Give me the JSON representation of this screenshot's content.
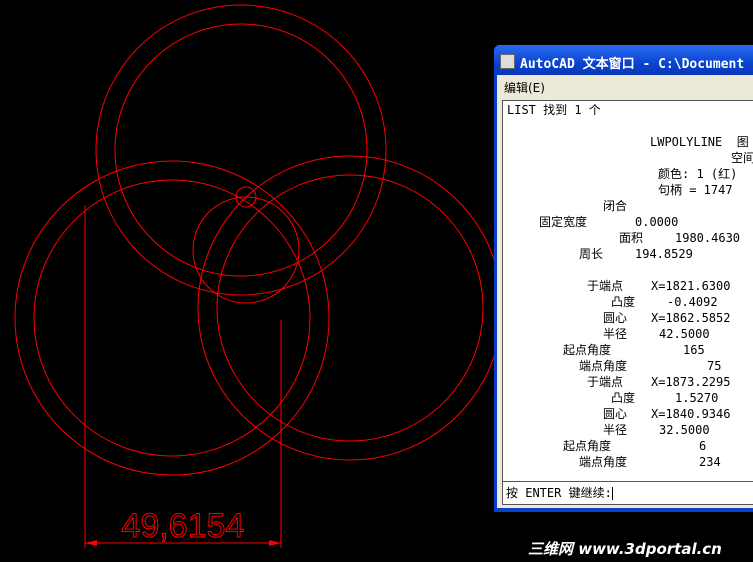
{
  "drawing": {
    "dimension": "49,6154",
    "color": "#ff0000"
  },
  "window": {
    "title": "AutoCAD 文本窗口 - C:\\Document",
    "menu": "编辑(E)",
    "header": "LIST 找到 1 个",
    "entity": "LWPOLYLINE  图",
    "space": "空间",
    "color": "颜色: 1 (红)",
    "handle": "句柄 = 1747",
    "closed": "闭合",
    "fixed_width_label": "固定宽度",
    "fixed_width": "0.0000",
    "area_label": "面积",
    "area": "1980.4630",
    "perimeter_label": "周长",
    "perimeter": "194.8529",
    "segments": [
      {
        "point_label": "于端点",
        "point": "X=1821.6300",
        "bulge_label": "凸度",
        "bulge": "-0.4092",
        "center_label": "圆心",
        "center": "X=1862.5852",
        "radius_label": "半径",
        "radius": "42.5000",
        "start_label": "起点角度",
        "start": "165",
        "end_label": "端点角度",
        "end": "75"
      },
      {
        "point_label": "于端点",
        "point": "X=1873.2295",
        "bulge_label": "凸度",
        "bulge": "1.5270",
        "center_label": "圆心",
        "center": "X=1840.9346",
        "radius_label": "半径",
        "radius": "32.5000",
        "start_label": "起点角度",
        "start": "6",
        "end_label": "端点角度",
        "end": "234"
      }
    ],
    "prompt": "按 ENTER 键继续:"
  },
  "watermark": "三维网 www.3dportal.cn"
}
